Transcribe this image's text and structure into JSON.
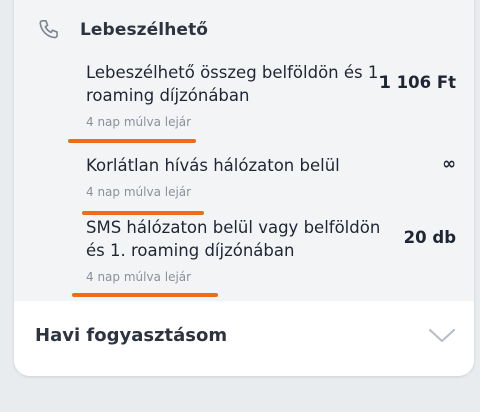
{
  "section": {
    "title": "Lebeszélhető",
    "icon": "phone-icon"
  },
  "items": [
    {
      "label": "Lebeszélhető összeg belföldön és 1. roaming díjzónában",
      "expiry": "4 nap múlva lejár",
      "value": "1 106 Ft"
    },
    {
      "label": "Korlátlan hívás hálózaton belül",
      "expiry": "4 nap múlva lejár",
      "value": "∞"
    },
    {
      "label": "SMS hálózaton belül vagy belföldön és 1. roaming díjzónában",
      "expiry": "4 nap múlva lejár",
      "value": "20 db"
    }
  ],
  "monthly": {
    "label": "Havi fogyasztásom",
    "icon": "chevron-down-icon"
  },
  "colors": {
    "background": "#e9ecef",
    "section_bg": "#f3f4f6",
    "card_bg": "#ffffff",
    "text": "#1f2633",
    "muted": "#8a919b",
    "annotation": "#f26a1b"
  }
}
